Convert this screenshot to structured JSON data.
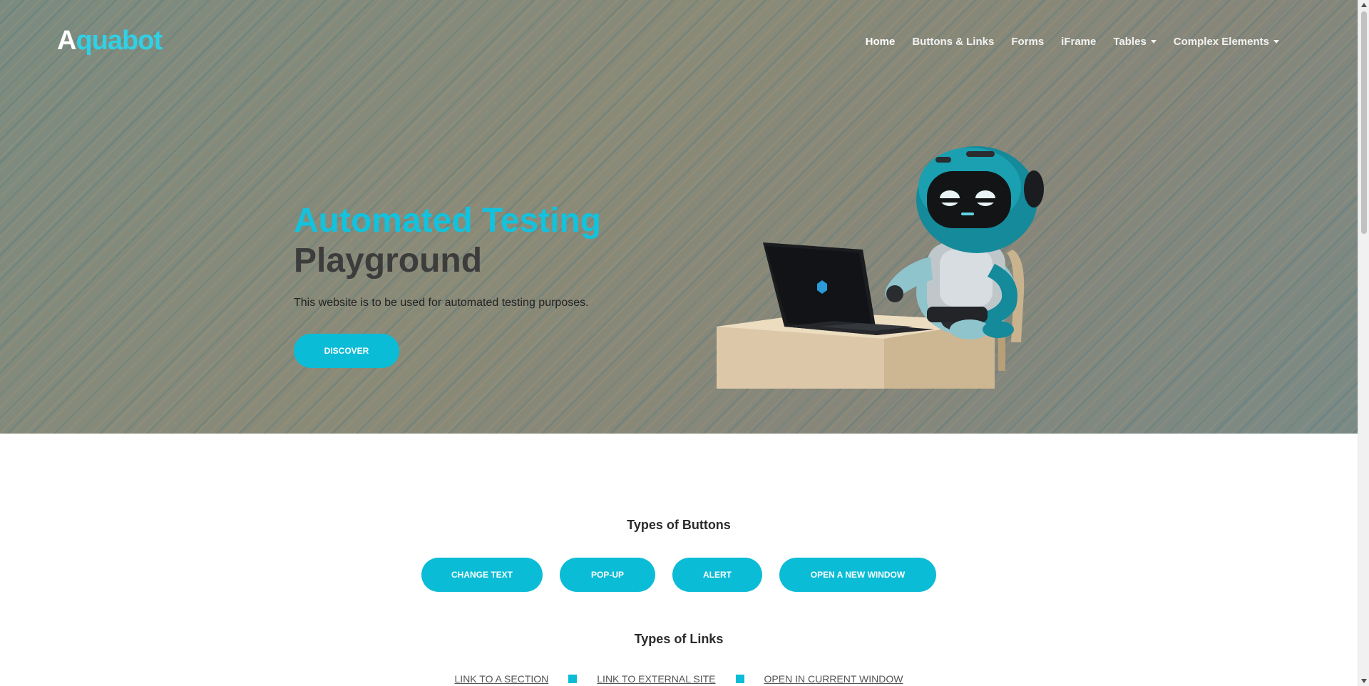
{
  "header": {
    "logo_first": "A",
    "logo_rest": "quabot",
    "nav": [
      {
        "label": "Home",
        "active": true
      },
      {
        "label": "Buttons & Links"
      },
      {
        "label": "Forms"
      },
      {
        "label": "iFrame"
      },
      {
        "label": "Tables",
        "dropdown": true
      },
      {
        "label": "Complex Elements",
        "dropdown": true
      }
    ]
  },
  "hero": {
    "title_line1": "Automated Testing",
    "title_line2": "Playground",
    "subtitle": "This website is to be used for automated testing purposes.",
    "cta": "DISCOVER"
  },
  "buttons_section": {
    "title": "Types of Buttons",
    "buttons": [
      "CHANGE TEXT",
      "POP-UP",
      "ALERT",
      "OPEN A NEW WINDOW"
    ]
  },
  "links_section": {
    "title": "Types of Links",
    "links": [
      "LINK TO A SECTION",
      "LINK TO EXTERNAL SITE",
      "OPEN IN CURRENT WINDOW"
    ]
  },
  "colors": {
    "accent": "#0bbcd6",
    "title_accent": "#13c2dc",
    "logo_accent": "#30d0e6"
  }
}
